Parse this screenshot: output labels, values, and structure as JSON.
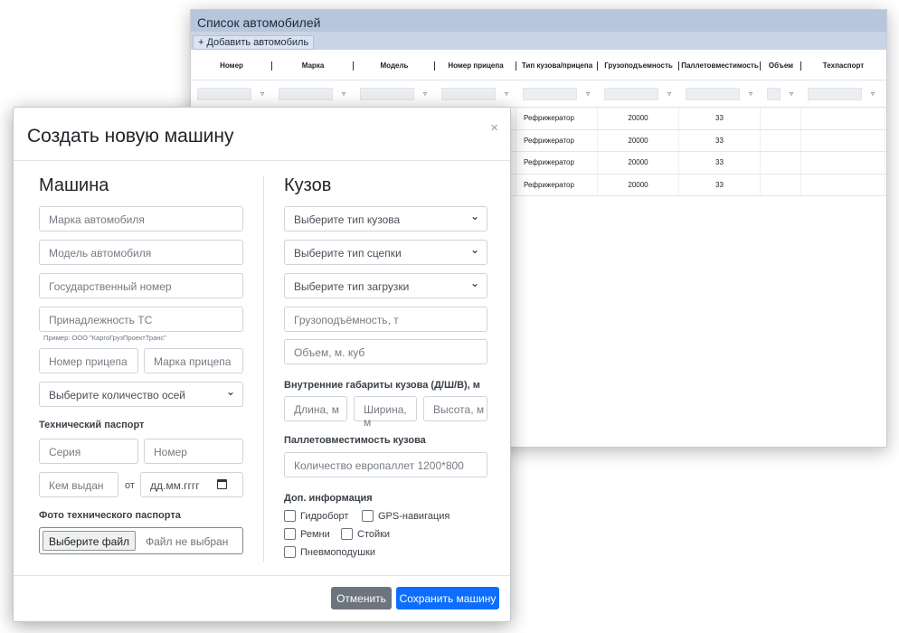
{
  "list": {
    "title": "Список автомобилей",
    "add_button": "+ Добавить автомобиль",
    "columns": [
      "Номер",
      "Марка",
      "Модель",
      "Номер прицепа",
      "Тип кузова/прицепа",
      "Грузоподъемность",
      "Паллетовместимость",
      "Объем",
      "Техпаспорт"
    ],
    "filter_icon": "▿",
    "rows": [
      {
        "body_type": "Рефрижератор",
        "capacity": "20000",
        "pallets": "33"
      },
      {
        "body_type": "Рефрижератор",
        "capacity": "20000",
        "pallets": "33"
      },
      {
        "body_type": "Рефрижератор",
        "capacity": "20000",
        "pallets": "33"
      },
      {
        "body_type": "Рефрижератор",
        "capacity": "20000",
        "pallets": "33"
      }
    ]
  },
  "modal": {
    "title": "Создать новую машину",
    "close": "×",
    "car": {
      "heading": "Машина",
      "brand_placeholder": "Марка автомобиля",
      "model_placeholder": "Модель автомобиля",
      "plate_placeholder": "Государственный номер",
      "owner_placeholder": "Принадлежность ТС",
      "owner_hint": "Пример: ООО \"КаргоГрузПроектТранс\"",
      "trailer_number_placeholder": "Номер прицепа",
      "trailer_brand_placeholder": "Марка прицепа",
      "axles_select": "Выберите количество осей",
      "passport_label": "Технический паспорт",
      "series_placeholder": "Серия",
      "number_placeholder": "Номер",
      "issued_by_placeholder": "Кем выдан",
      "from_label": "от",
      "date_placeholder": "дд.мм.гггг",
      "photo_label": "Фото технического паспорта",
      "file_button": "Выберите файл",
      "file_none": "Файл не выбран"
    },
    "body": {
      "heading": "Кузов",
      "body_type_select": "Выберите тип кузова",
      "hitch_type_select": "Выберите тип сцепки",
      "loading_type_select": "Выберите тип загрузки",
      "capacity_placeholder": "Грузоподъёмность, т",
      "volume_placeholder": "Объем, м. куб",
      "dimensions_label": "Внутренние габариты кузова (Д/Ш/В), м",
      "length_placeholder": "Длина, м",
      "width_placeholder": "Ширина, м",
      "height_placeholder": "Высота, м",
      "pallets_label": "Паллетовместимость кузова",
      "pallets_placeholder": "Количество европаллет 1200*800",
      "extra_label": "Доп. информация",
      "options": [
        "Гидроборт",
        "GPS-навигация",
        "Ремни",
        "Стойки",
        "Пневмоподушки"
      ]
    },
    "footer": {
      "cancel": "Отменить",
      "save": "Сохранить машину"
    }
  }
}
